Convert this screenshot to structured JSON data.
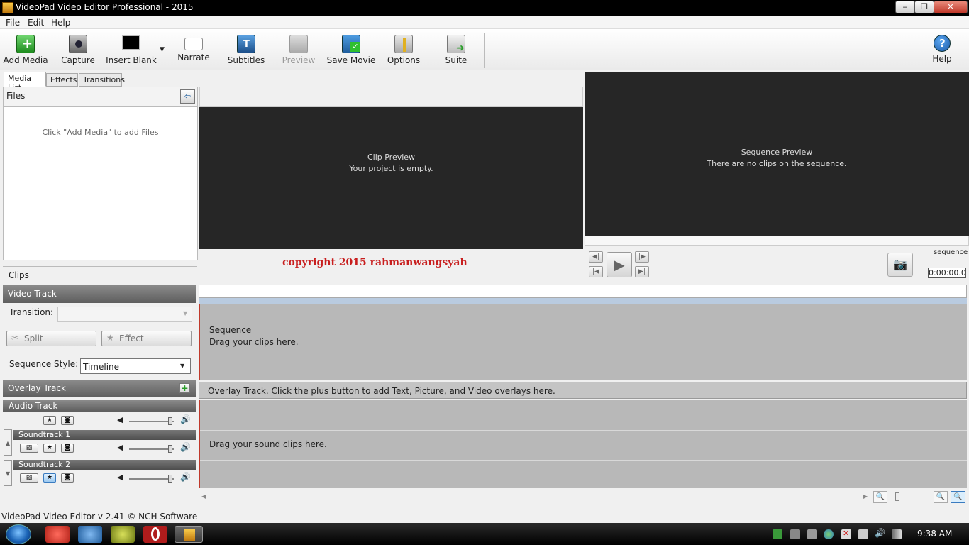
{
  "window": {
    "title": "VideoPad Video Editor Professional - 2015"
  },
  "menu": [
    "File",
    "Edit",
    "Help"
  ],
  "toolbar": {
    "add_media": "Add Media",
    "capture": "Capture",
    "insert_blank": "Insert Blank",
    "narrate": "Narrate",
    "subtitles": "Subtitles",
    "preview": "Preview",
    "save_movie": "Save Movie",
    "options": "Options",
    "suite": "Suite",
    "help": "Help"
  },
  "tabs": [
    "Media List",
    "Effects",
    "Transitions"
  ],
  "files": {
    "header": "Files",
    "empty_hint": "Click \"Add Media\" to add Files"
  },
  "clip_preview": {
    "title": "Clip Preview",
    "message": "Your project is empty."
  },
  "sequence_preview": {
    "title": "Sequence Preview",
    "message": "There are no clips on the sequence.",
    "tab_label": "sequence",
    "time": "0:00:00.0"
  },
  "watermark": "copyright 2015 rahmanwangsyah",
  "clips_header": "Clips",
  "video_track": {
    "title": "Video Track",
    "transition_label": "Transition:",
    "split_label": "Split",
    "effect_label": "Effect",
    "sequence_style_label": "Sequence Style:",
    "sequence_style_value": "Timeline"
  },
  "overlay_track": {
    "title": "Overlay Track",
    "hint": "Overlay Track. Click the plus button to add Text, Picture, and Video overlays here."
  },
  "audio_track": {
    "title": "Audio Track",
    "soundtrack1": "Soundtrack 1",
    "soundtrack2": "Soundtrack 2",
    "hint": "Drag your sound clips here."
  },
  "sequence_track": {
    "title": "Sequence",
    "hint": "Drag your clips here."
  },
  "status": "VideoPad Video Editor v 2.41 © NCH Software",
  "taskbar": {
    "clock": "9:38 AM"
  },
  "colors": {
    "watermark": "#c81e1e",
    "preview_bg": "#262626",
    "timeline_bg": "#b8b8b8",
    "track_marker": "#c0392b"
  }
}
